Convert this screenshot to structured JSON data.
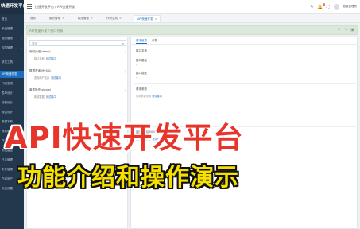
{
  "app": {
    "brand": "快速开发平台"
  },
  "sidebar": {
    "items": [
      {
        "label": "首页"
      },
      {
        "label": "系统管理"
      },
      {
        "label": "组织管理"
      },
      {
        "label": "权限管理"
      },
      {
        "label": "研发工具"
      },
      {
        "label": "API快速开发"
      },
      {
        "label": "代码生成"
      },
      {
        "label": "表单设计"
      },
      {
        "label": "流程设计"
      },
      {
        "label": "报表设计"
      },
      {
        "label": "数据字典"
      },
      {
        "label": "消息管理"
      },
      {
        "label": "任务调度"
      },
      {
        "label": "系统监控"
      },
      {
        "label": "日志管理"
      },
      {
        "label": "文件管理"
      },
      {
        "label": "在线用户"
      },
      {
        "label": "系统设置"
      }
    ]
  },
  "topbar": {
    "breadcrumb": "快速开发平台 / API快速开发",
    "bell_count": "1",
    "user": "超级管理员"
  },
  "tabs": [
    {
      "label": "首页"
    },
    {
      "label": "组织管理"
    },
    {
      "label": "权限管理"
    },
    {
      "label": "代码生成"
    },
    {
      "label": "API快速开发"
    }
  ],
  "toolbar": {
    "path": "API快速开发 / 接口列表"
  },
  "left_panel": {
    "search_placeholder": "搜索",
    "groups": [
      {
        "title": "测试分组(demo)",
        "child": "接口名称",
        "link": "测试接口"
      },
      {
        "title": "数据查询(MySQL)",
        "child": "查询用户信息",
        "link": "测试接口"
      },
      {
        "title": "单表操作(single)",
        "child": "新增数据",
        "link": "测试接口"
      }
    ]
  },
  "right_panel": {
    "tabs": [
      "基本信息",
      "参数"
    ],
    "labels": {
      "name": "接口名称",
      "path": "接口路径",
      "desc": "接口描述",
      "section1": "请求参数",
      "section1_val": "请求参数说明",
      "section2": "返回结果(JSON)",
      "section2_val": "返回结果说明"
    },
    "link": "测试接口"
  },
  "overlay": {
    "title": "API快速开发平台",
    "subtitle": "功能介绍和操作演示"
  }
}
